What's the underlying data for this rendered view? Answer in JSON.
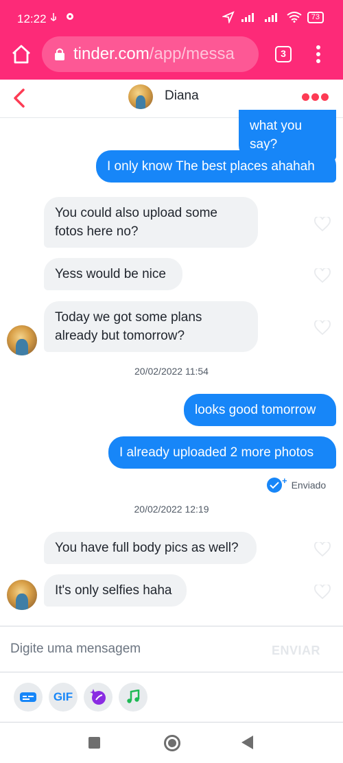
{
  "status_bar": {
    "time": "12:22",
    "battery": "73"
  },
  "browser": {
    "url_domain": "tinder.com",
    "url_path": "/app/messa",
    "tab_count": "3"
  },
  "chat_header": {
    "name": "Diana"
  },
  "messages": [
    {
      "dir": "sent",
      "text": "what you say?"
    },
    {
      "dir": "sent",
      "text": "I only know The best places ahahah"
    },
    {
      "dir": "received",
      "text": "You could also upload some fotos here no?"
    },
    {
      "dir": "received",
      "text": "Yess would be nice"
    },
    {
      "dir": "received",
      "text": "Today we got some plans already but tomorrow?"
    },
    {
      "dir": "sent",
      "text": "looks good tomorrow"
    },
    {
      "dir": "sent",
      "text": "I already uploaded 2 more photos"
    },
    {
      "dir": "received",
      "text": "You have full body pics as well?"
    },
    {
      "dir": "received",
      "text": "It's only selfies haha"
    }
  ],
  "timestamps": [
    "20/02/2022 11:54",
    "20/02/2022 12:19"
  ],
  "sent_status": "Enviado",
  "composer": {
    "placeholder": "Digite uma mensagem",
    "send_label": "ENVIAR"
  },
  "tools": {
    "gif_label": "GIF"
  },
  "icons": [
    "home-icon",
    "lock-icon",
    "tabs-icon",
    "menu-icon",
    "back-arrow-icon",
    "more-options-icon",
    "heart-icon",
    "read-receipt-icon",
    "sticker-icon",
    "gif-icon",
    "spark-icon",
    "music-icon"
  ],
  "colors": {
    "brand_pink": "#fd2a78",
    "sent_bubble": "#1786f8",
    "received_bubble": "#f0f2f4",
    "accent_red": "#fd3b54"
  }
}
